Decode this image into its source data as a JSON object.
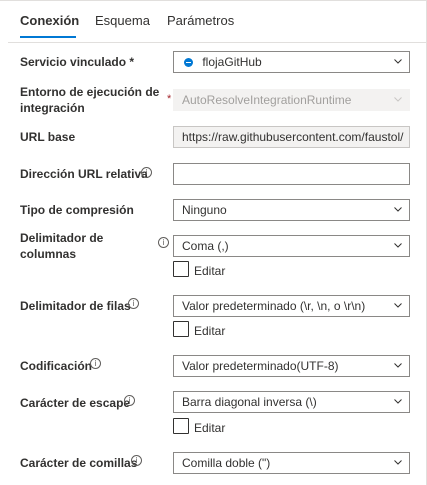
{
  "tabs": [
    {
      "label": "Conexión",
      "active": true
    },
    {
      "label": "Esquema",
      "active": false
    },
    {
      "label": "Parámetros",
      "active": false
    }
  ],
  "fields": {
    "linked_service": {
      "label": "Servicio vinculado *",
      "value": "flojaGitHub",
      "icon": "linked-service-dot-icon"
    },
    "integration_runtime": {
      "label_line1": "Entorno de ejecución de",
      "label_line2": "integración",
      "required_mark": "*",
      "value": "AutoResolveIntegrationRuntime"
    },
    "base_url": {
      "label": "URL base",
      "value": "https://raw.githubusercontent.com/faustol/"
    },
    "relative_url": {
      "label": "Dirección URL relativa",
      "value": ""
    },
    "compression_type": {
      "label": "Tipo de compresión",
      "value": "Ninguno"
    },
    "column_delimiter": {
      "label_line1": "Delimitador de",
      "label_line2": "columnas",
      "value": "Coma (,)",
      "edit_label": "Editar"
    },
    "row_delimiter": {
      "label": "Delimitador de filas",
      "value": "Valor predeterminado (\\r, \\n, o \\r\\n)",
      "edit_label": "Editar"
    },
    "encoding": {
      "label": "Codificación",
      "value": "Valor predeterminado(UTF-8)"
    },
    "escape_character": {
      "label": "Carácter de escape",
      "value": "Barra diagonal inversa (\\)",
      "edit_label": "Editar"
    },
    "quote_character": {
      "label": "Carácter de comillas",
      "value": "Comilla doble (\")"
    }
  },
  "icons": {
    "info": "i"
  },
  "colors": {
    "accent": "#0078d4",
    "required": "#a4262c",
    "disabled_bg": "#f3f2f1"
  }
}
